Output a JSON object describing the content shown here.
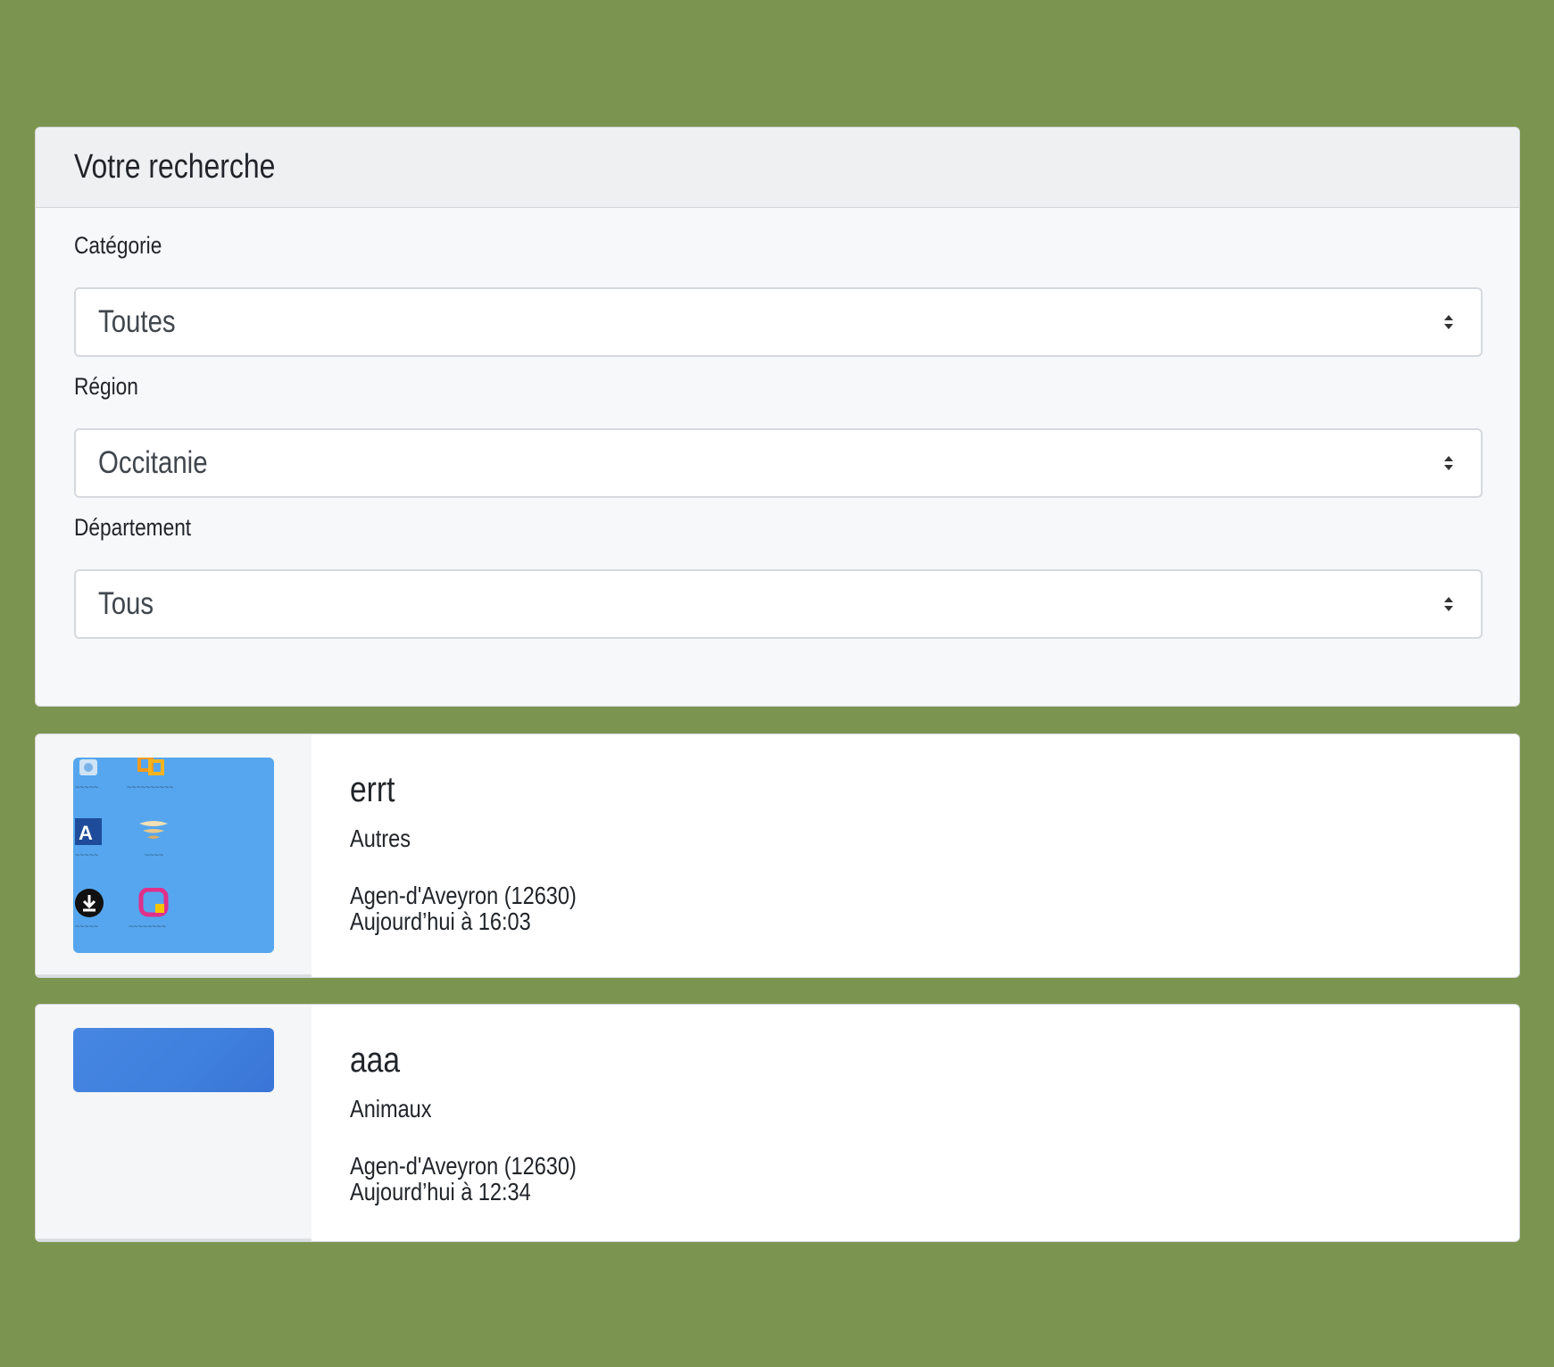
{
  "search": {
    "title": "Votre recherche",
    "fields": [
      {
        "label": "Catégorie",
        "value": "Toutes"
      },
      {
        "label": "Région",
        "value": "Occitanie"
      },
      {
        "label": "Département",
        "value": "Tous"
      }
    ]
  },
  "listings": [
    {
      "title": "errt",
      "category": "Autres",
      "location": "Agen-d'Aveyron (12630)",
      "date": "Aujourd’hui à 16:03",
      "thumbnail": "desktop-screenshot-image"
    },
    {
      "title": "aaa",
      "category": "Animaux",
      "location": "Agen-d'Aveyron (12630)",
      "date": "Aujourd’hui à 12:34",
      "thumbnail": "blue-gradient-image"
    }
  ],
  "colors": {
    "page_background": "#7b944f",
    "card_background": "#f7f8f9",
    "header_background": "#eef0f2",
    "text": "#212529"
  }
}
